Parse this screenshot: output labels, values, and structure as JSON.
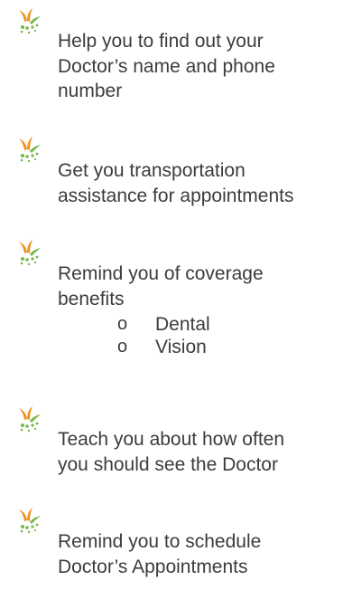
{
  "bullets": [
    {
      "icon": "orange-green-starburst-bullet",
      "lines": [
        "Help you to find out your",
        "Doctor’s name and phone",
        "number"
      ]
    },
    {
      "icon": "orange-green-starburst-bullet",
      "lines": [
        "Get you transportation",
        "assistance for appointments"
      ]
    },
    {
      "icon": "orange-green-starburst-bullet",
      "lines": [
        "Remind you of coverage",
        "benefits"
      ],
      "subitems": [
        {
          "marker": "o",
          "label": "Dental"
        },
        {
          "marker": "o",
          "label": "Vision"
        }
      ]
    },
    {
      "icon": "orange-green-starburst-bullet",
      "lines": [
        "Teach you about how often",
        "you should see the Doctor"
      ]
    },
    {
      "icon": "orange-green-starburst-bullet",
      "lines": [
        "Remind you to schedule",
        "Doctor’s Appointments"
      ]
    }
  ],
  "colors": {
    "text": "#3c3c3c",
    "bullet_orange": "#f0921e",
    "bullet_green": "#7ab648"
  }
}
